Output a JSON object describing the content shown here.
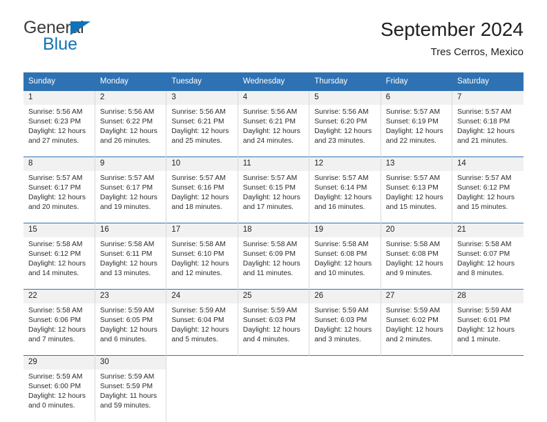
{
  "brand": {
    "name_top": "General",
    "name_bottom": "Blue",
    "logo_icon": "triangle-icon",
    "color_blue": "#1173b6",
    "color_gray": "#3b3b3b"
  },
  "header": {
    "title": "September 2024",
    "subtitle": "Tres Cerros, Mexico"
  },
  "theme": {
    "header_blue": "#2e72b3",
    "daynum_bg": "#f1f1f1",
    "grid_line": "#d8d8d8",
    "text": "#222222"
  },
  "calendar": {
    "weekday_headers": [
      "Sunday",
      "Monday",
      "Tuesday",
      "Wednesday",
      "Thursday",
      "Friday",
      "Saturday"
    ],
    "weeks": [
      [
        {
          "day": "1",
          "sunrise": "Sunrise: 5:56 AM",
          "sunset": "Sunset: 6:23 PM",
          "daylight1": "Daylight: 12 hours",
          "daylight2": "and 27 minutes."
        },
        {
          "day": "2",
          "sunrise": "Sunrise: 5:56 AM",
          "sunset": "Sunset: 6:22 PM",
          "daylight1": "Daylight: 12 hours",
          "daylight2": "and 26 minutes."
        },
        {
          "day": "3",
          "sunrise": "Sunrise: 5:56 AM",
          "sunset": "Sunset: 6:21 PM",
          "daylight1": "Daylight: 12 hours",
          "daylight2": "and 25 minutes."
        },
        {
          "day": "4",
          "sunrise": "Sunrise: 5:56 AM",
          "sunset": "Sunset: 6:21 PM",
          "daylight1": "Daylight: 12 hours",
          "daylight2": "and 24 minutes."
        },
        {
          "day": "5",
          "sunrise": "Sunrise: 5:56 AM",
          "sunset": "Sunset: 6:20 PM",
          "daylight1": "Daylight: 12 hours",
          "daylight2": "and 23 minutes."
        },
        {
          "day": "6",
          "sunrise": "Sunrise: 5:57 AM",
          "sunset": "Sunset: 6:19 PM",
          "daylight1": "Daylight: 12 hours",
          "daylight2": "and 22 minutes."
        },
        {
          "day": "7",
          "sunrise": "Sunrise: 5:57 AM",
          "sunset": "Sunset: 6:18 PM",
          "daylight1": "Daylight: 12 hours",
          "daylight2": "and 21 minutes."
        }
      ],
      [
        {
          "day": "8",
          "sunrise": "Sunrise: 5:57 AM",
          "sunset": "Sunset: 6:17 PM",
          "daylight1": "Daylight: 12 hours",
          "daylight2": "and 20 minutes."
        },
        {
          "day": "9",
          "sunrise": "Sunrise: 5:57 AM",
          "sunset": "Sunset: 6:17 PM",
          "daylight1": "Daylight: 12 hours",
          "daylight2": "and 19 minutes."
        },
        {
          "day": "10",
          "sunrise": "Sunrise: 5:57 AM",
          "sunset": "Sunset: 6:16 PM",
          "daylight1": "Daylight: 12 hours",
          "daylight2": "and 18 minutes."
        },
        {
          "day": "11",
          "sunrise": "Sunrise: 5:57 AM",
          "sunset": "Sunset: 6:15 PM",
          "daylight1": "Daylight: 12 hours",
          "daylight2": "and 17 minutes."
        },
        {
          "day": "12",
          "sunrise": "Sunrise: 5:57 AM",
          "sunset": "Sunset: 6:14 PM",
          "daylight1": "Daylight: 12 hours",
          "daylight2": "and 16 minutes."
        },
        {
          "day": "13",
          "sunrise": "Sunrise: 5:57 AM",
          "sunset": "Sunset: 6:13 PM",
          "daylight1": "Daylight: 12 hours",
          "daylight2": "and 15 minutes."
        },
        {
          "day": "14",
          "sunrise": "Sunrise: 5:57 AM",
          "sunset": "Sunset: 6:12 PM",
          "daylight1": "Daylight: 12 hours",
          "daylight2": "and 15 minutes."
        }
      ],
      [
        {
          "day": "15",
          "sunrise": "Sunrise: 5:58 AM",
          "sunset": "Sunset: 6:12 PM",
          "daylight1": "Daylight: 12 hours",
          "daylight2": "and 14 minutes."
        },
        {
          "day": "16",
          "sunrise": "Sunrise: 5:58 AM",
          "sunset": "Sunset: 6:11 PM",
          "daylight1": "Daylight: 12 hours",
          "daylight2": "and 13 minutes."
        },
        {
          "day": "17",
          "sunrise": "Sunrise: 5:58 AM",
          "sunset": "Sunset: 6:10 PM",
          "daylight1": "Daylight: 12 hours",
          "daylight2": "and 12 minutes."
        },
        {
          "day": "18",
          "sunrise": "Sunrise: 5:58 AM",
          "sunset": "Sunset: 6:09 PM",
          "daylight1": "Daylight: 12 hours",
          "daylight2": "and 11 minutes."
        },
        {
          "day": "19",
          "sunrise": "Sunrise: 5:58 AM",
          "sunset": "Sunset: 6:08 PM",
          "daylight1": "Daylight: 12 hours",
          "daylight2": "and 10 minutes."
        },
        {
          "day": "20",
          "sunrise": "Sunrise: 5:58 AM",
          "sunset": "Sunset: 6:08 PM",
          "daylight1": "Daylight: 12 hours",
          "daylight2": "and 9 minutes."
        },
        {
          "day": "21",
          "sunrise": "Sunrise: 5:58 AM",
          "sunset": "Sunset: 6:07 PM",
          "daylight1": "Daylight: 12 hours",
          "daylight2": "and 8 minutes."
        }
      ],
      [
        {
          "day": "22",
          "sunrise": "Sunrise: 5:58 AM",
          "sunset": "Sunset: 6:06 PM",
          "daylight1": "Daylight: 12 hours",
          "daylight2": "and 7 minutes."
        },
        {
          "day": "23",
          "sunrise": "Sunrise: 5:59 AM",
          "sunset": "Sunset: 6:05 PM",
          "daylight1": "Daylight: 12 hours",
          "daylight2": "and 6 minutes."
        },
        {
          "day": "24",
          "sunrise": "Sunrise: 5:59 AM",
          "sunset": "Sunset: 6:04 PM",
          "daylight1": "Daylight: 12 hours",
          "daylight2": "and 5 minutes."
        },
        {
          "day": "25",
          "sunrise": "Sunrise: 5:59 AM",
          "sunset": "Sunset: 6:03 PM",
          "daylight1": "Daylight: 12 hours",
          "daylight2": "and 4 minutes."
        },
        {
          "day": "26",
          "sunrise": "Sunrise: 5:59 AM",
          "sunset": "Sunset: 6:03 PM",
          "daylight1": "Daylight: 12 hours",
          "daylight2": "and 3 minutes."
        },
        {
          "day": "27",
          "sunrise": "Sunrise: 5:59 AM",
          "sunset": "Sunset: 6:02 PM",
          "daylight1": "Daylight: 12 hours",
          "daylight2": "and 2 minutes."
        },
        {
          "day": "28",
          "sunrise": "Sunrise: 5:59 AM",
          "sunset": "Sunset: 6:01 PM",
          "daylight1": "Daylight: 12 hours",
          "daylight2": "and 1 minute."
        }
      ],
      [
        {
          "day": "29",
          "sunrise": "Sunrise: 5:59 AM",
          "sunset": "Sunset: 6:00 PM",
          "daylight1": "Daylight: 12 hours",
          "daylight2": "and 0 minutes."
        },
        {
          "day": "30",
          "sunrise": "Sunrise: 5:59 AM",
          "sunset": "Sunset: 5:59 PM",
          "daylight1": "Daylight: 11 hours",
          "daylight2": "and 59 minutes."
        },
        {
          "day": "",
          "sunrise": "",
          "sunset": "",
          "daylight1": "",
          "daylight2": ""
        },
        {
          "day": "",
          "sunrise": "",
          "sunset": "",
          "daylight1": "",
          "daylight2": ""
        },
        {
          "day": "",
          "sunrise": "",
          "sunset": "",
          "daylight1": "",
          "daylight2": ""
        },
        {
          "day": "",
          "sunrise": "",
          "sunset": "",
          "daylight1": "",
          "daylight2": ""
        },
        {
          "day": "",
          "sunrise": "",
          "sunset": "",
          "daylight1": "",
          "daylight2": ""
        }
      ]
    ]
  }
}
